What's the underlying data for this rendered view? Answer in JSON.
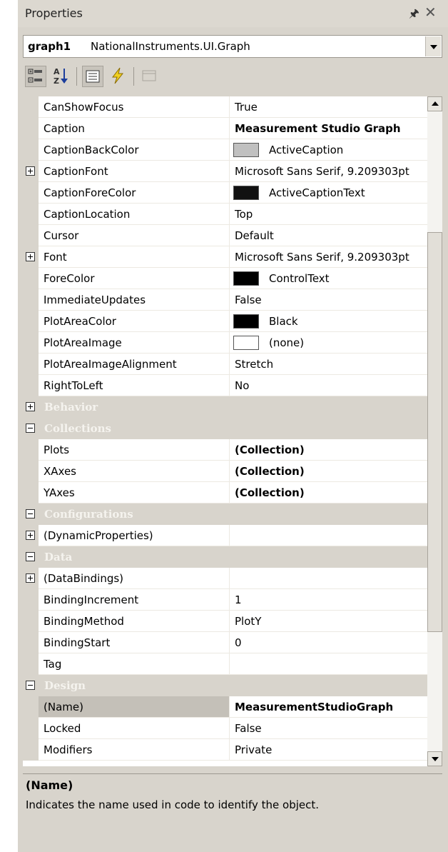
{
  "window": {
    "title": "Properties"
  },
  "object_selector": {
    "name": "graph1",
    "type": "NationalInstruments.UI.Graph"
  },
  "properties": {
    "CanShowFocus": {
      "name": "CanShowFocus",
      "value": "True"
    },
    "Caption": {
      "name": "Caption",
      "value": "Measurement Studio Graph"
    },
    "CaptionBackColor": {
      "name": "CaptionBackColor",
      "value": "ActiveCaption",
      "color": "#c0c0c0"
    },
    "CaptionFont": {
      "name": "CaptionFont",
      "value": "Microsoft Sans Serif, 9.209303pt"
    },
    "CaptionForeColor": {
      "name": "CaptionForeColor",
      "value": "ActiveCaptionText",
      "color": "#111111"
    },
    "CaptionLocation": {
      "name": "CaptionLocation",
      "value": "Top"
    },
    "Cursor": {
      "name": "Cursor",
      "value": "Default"
    },
    "Font": {
      "name": "Font",
      "value": "Microsoft Sans Serif, 9.209303pt"
    },
    "ForeColor": {
      "name": "ForeColor",
      "value": "ControlText",
      "color": "#000000"
    },
    "ImmediateUpdates": {
      "name": "ImmediateUpdates",
      "value": "False"
    },
    "PlotAreaColor": {
      "name": "PlotAreaColor",
      "value": "Black",
      "color": "#000000"
    },
    "PlotAreaImage": {
      "name": "PlotAreaImage",
      "value": "(none)",
      "color": "#ffffff"
    },
    "PlotAreaImageAlignment": {
      "name": "PlotAreaImageAlignment",
      "value": "Stretch"
    },
    "RightToLeft": {
      "name": "RightToLeft",
      "value": "No"
    },
    "Plots": {
      "name": "Plots",
      "value": "(Collection)"
    },
    "XAxes": {
      "name": "XAxes",
      "value": "(Collection)"
    },
    "YAxes": {
      "name": "YAxes",
      "value": "(Collection)"
    },
    "DynamicProperties": {
      "name": "(DynamicProperties)",
      "value": ""
    },
    "DataBindings": {
      "name": "(DataBindings)",
      "value": ""
    },
    "BindingIncrement": {
      "name": "BindingIncrement",
      "value": "1"
    },
    "BindingMethod": {
      "name": "BindingMethod",
      "value": "PlotY"
    },
    "BindingStart": {
      "name": "BindingStart",
      "value": "0"
    },
    "Tag": {
      "name": "Tag",
      "value": ""
    },
    "Name": {
      "name": "(Name)",
      "value": "MeasurementStudioGraph"
    },
    "Locked": {
      "name": "Locked",
      "value": "False"
    },
    "Modifiers": {
      "name": "Modifiers",
      "value": "Private"
    }
  },
  "categories": {
    "Behavior": "Behavior",
    "Collections": "Collections",
    "Configurations": "Configurations",
    "Data": "Data",
    "Design": "Design"
  },
  "description": {
    "title": "(Name)",
    "text": "Indicates the name used in code to identify the object."
  }
}
